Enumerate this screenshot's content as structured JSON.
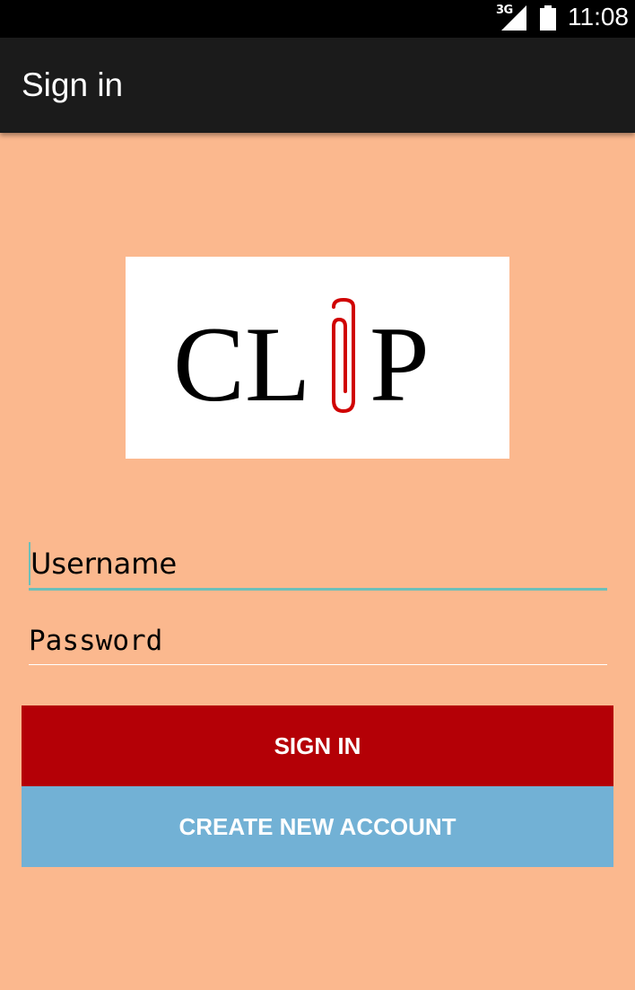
{
  "status_bar": {
    "network": "3G",
    "time": "11:08",
    "signal_icon": "signal-icon",
    "battery_icon": "battery-icon"
  },
  "app_bar": {
    "title": "Sign in"
  },
  "logo": {
    "text": "CLIP",
    "colors": {
      "letters": "#000000",
      "paperclip": "#d00000",
      "background": "#ffffff"
    }
  },
  "form": {
    "username_placeholder": "Username",
    "password_placeholder": "Password"
  },
  "buttons": {
    "sign_in": "SIGN IN",
    "create_account": "CREATE NEW ACCOUNT"
  },
  "colors": {
    "background": "#fbb88e",
    "app_bar": "#1b1b1b",
    "sign_in_button": "#b40006",
    "create_button": "#72b1d5",
    "input_accent": "#6cbfb9"
  }
}
